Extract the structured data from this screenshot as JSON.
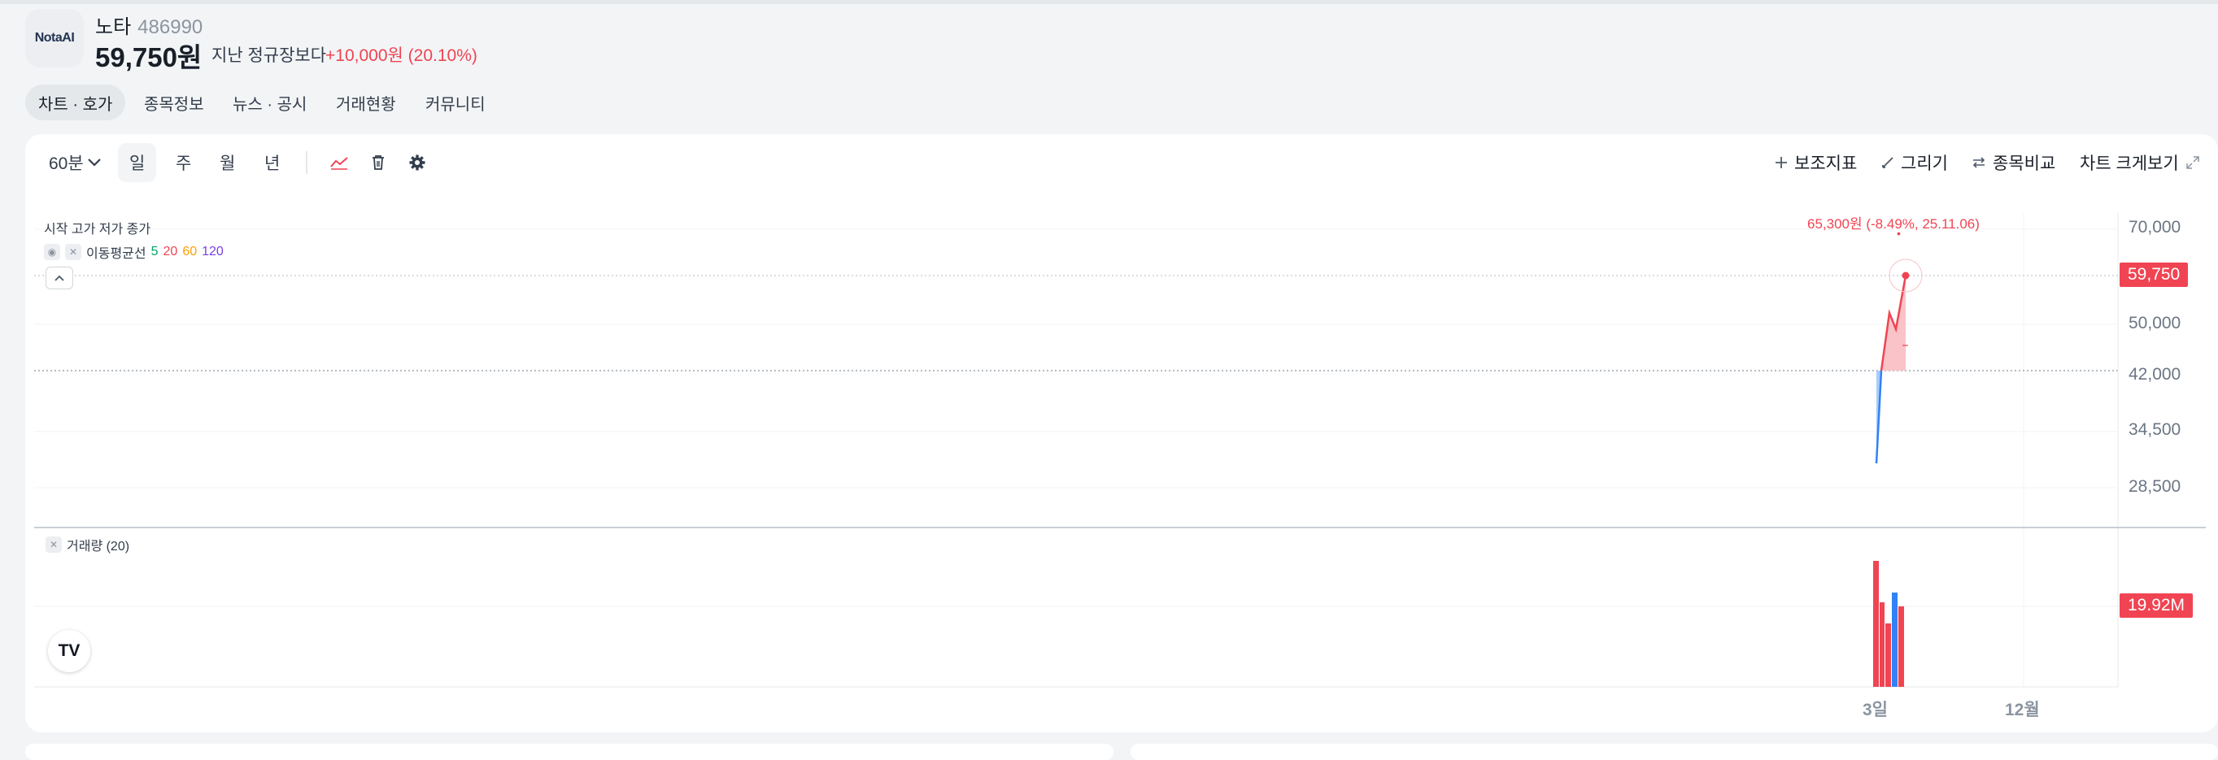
{
  "header": {
    "logo_text": "NotaAI",
    "stock_name": "노타",
    "stock_code": "486990",
    "price": "59,750원",
    "vs_label": "지난 정규장보다",
    "change": "+10,000원 (20.10%)"
  },
  "tabs": [
    "차트 · 호가",
    "종목정보",
    "뉴스 · 공시",
    "거래현황",
    "커뮤니티"
  ],
  "toolbar": {
    "interval": "60분",
    "periods": [
      "일",
      "주",
      "월",
      "년"
    ],
    "indicators": "보조지표",
    "draw": "그리기",
    "compare": "종목비교",
    "expand": "차트 크게보기"
  },
  "legend": {
    "ohlc": "시작 고가 저가 종가",
    "ma_label": "이동평균선",
    "ma_periods": [
      {
        "label": "5",
        "color": "#00a86b"
      },
      {
        "label": "20",
        "color": "#f04452"
      },
      {
        "label": "60",
        "color": "#ff9f00"
      },
      {
        "label": "120",
        "color": "#7b3fe4"
      }
    ],
    "volume_label": "거래량 (20)"
  },
  "price_axis": [
    "70,000",
    "50,000",
    "42,000",
    "34,500",
    "28,500"
  ],
  "current_price_badge": "59,750",
  "volume_badge": "19.92M",
  "x_axis": [
    "3일",
    "12월"
  ],
  "high_annotation": "65,300원 (-8.49%, 25.11.06)",
  "tv_logo_text": "TV",
  "chart_data": {
    "type": "line",
    "x": [
      "3일",
      "12월"
    ],
    "price_series": [
      30500,
      42000,
      51000,
      49000,
      56500,
      59750
    ],
    "reference_price": 42000,
    "current_price": 59750,
    "high_marker": {
      "value": 65300,
      "label": "65,300원 (-8.49%, 25.11.06)"
    },
    "volume": {
      "last_value_label": "19.92M"
    },
    "y_ticks": [
      "70,000",
      "50,000",
      "42,000",
      "34,500",
      "28,500"
    ],
    "colors": {
      "up": "#f04452",
      "down": "#3182f6"
    }
  }
}
